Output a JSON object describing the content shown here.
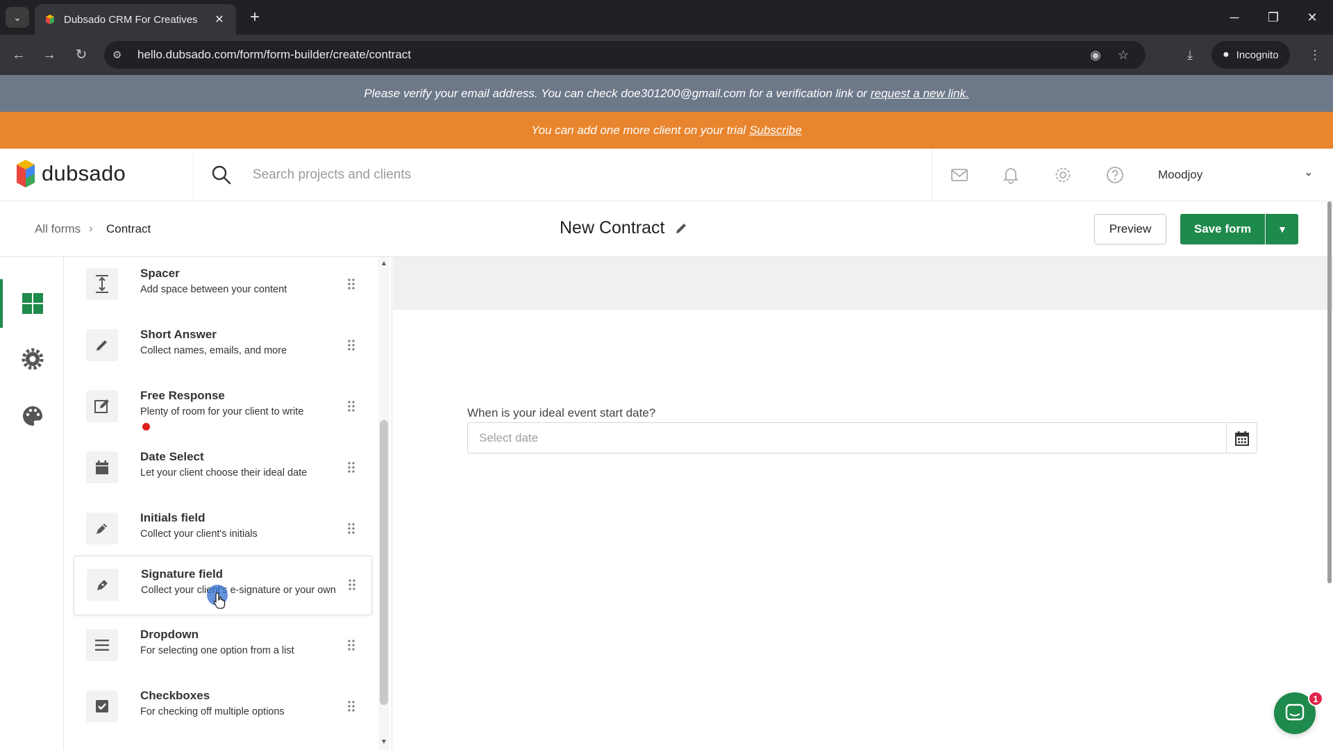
{
  "browser": {
    "tab_title": "Dubsado CRM For Creatives",
    "url": "hello.dubsado.com/form/form-builder/create/contract",
    "incognito_label": "Incognito"
  },
  "banners": {
    "verify_text": "Please verify your email address. You can check doe301200@gmail.com for a verification link or",
    "verify_link": "request a new link.",
    "trial_text": "You can add one more client on your trial",
    "trial_link": "Subscribe"
  },
  "header": {
    "logo_text": "dubsado",
    "search_placeholder": "Search projects and clients",
    "user_name": "Moodjoy"
  },
  "builder": {
    "breadcrumb_all": "All forms",
    "breadcrumb_sep": "›",
    "breadcrumb_current": "Contract",
    "title": "New Contract",
    "preview_label": "Preview",
    "save_label": "Save form"
  },
  "elements": [
    {
      "title": "Spacer",
      "desc": "Add space between your content",
      "icon": "spacer-icon"
    },
    {
      "title": "Short Answer",
      "desc": "Collect names, emails, and more",
      "icon": "pencil-icon"
    },
    {
      "title": "Free Response",
      "desc": "Plenty of room for your client to write",
      "icon": "edit-box-icon"
    },
    {
      "title": "Date Select",
      "desc": "Let your client choose their ideal date",
      "icon": "calendar-icon"
    },
    {
      "title": "Initials field",
      "desc": "Collect your client's initials",
      "icon": "pen-icon"
    },
    {
      "title": "Signature field",
      "desc": "Collect your client's e-signature or your own",
      "icon": "signature-pen-icon"
    },
    {
      "title": "Dropdown",
      "desc": "For selecting one option from a list",
      "icon": "list-icon"
    },
    {
      "title": "Checkboxes",
      "desc": "For checking off multiple options",
      "icon": "checkbox-icon"
    }
  ],
  "canvas": {
    "field_label": "When is your ideal event start date?",
    "date_placeholder": "Select date"
  },
  "chat": {
    "badge_count": "1"
  },
  "colors": {
    "brand_green": "#1e8a4c",
    "trial_orange": "#e8852e",
    "verify_gray": "#6d7889"
  }
}
